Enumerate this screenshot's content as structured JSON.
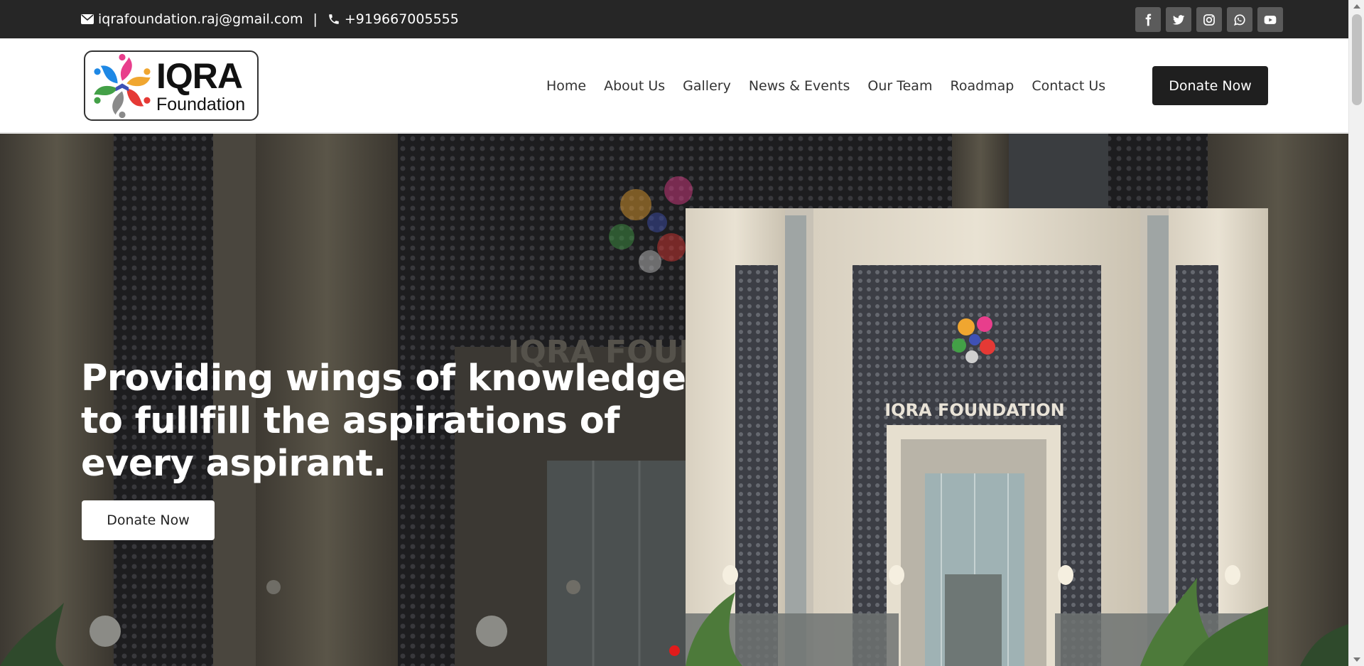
{
  "topbar": {
    "email": "iqrafoundation.raj@gmail.com",
    "separator": "|",
    "phone": "+919667005555",
    "socials": [
      "facebook-icon",
      "twitter-icon",
      "instagram-icon",
      "whatsapp-icon",
      "youtube-icon"
    ]
  },
  "logo": {
    "title": "IQRA",
    "subtitle": "Foundation"
  },
  "nav": {
    "items": [
      "Home",
      "About Us",
      "Gallery",
      "News & Events",
      "Our Team",
      "Roadmap",
      "Contact Us"
    ],
    "donate_label": "Donate Now"
  },
  "hero": {
    "heading": "Providing wings of knowledge to fullfill the aspirations of every aspirant.",
    "donate_label": "Donate Now",
    "building_sign": "IQRA FOUNDATION",
    "background_sign": "IQRA FOUN"
  },
  "colors": {
    "topbar_bg": "#262626",
    "social_bg": "#5b5b5b",
    "donate_bg": "#1f1f1f",
    "slider_dot": "#e21b1b"
  }
}
